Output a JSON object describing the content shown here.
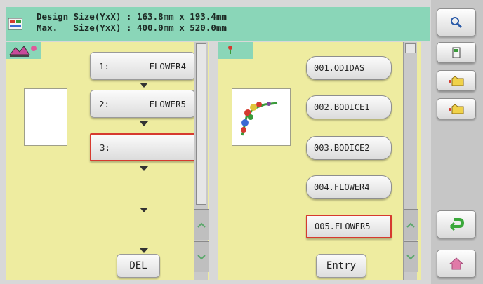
{
  "header": {
    "line1": "Design Size(YxX) : 163.8mm x 193.4mm",
    "line2": "Max.   Size(YxX) : 400.0mm x 520.0mm"
  },
  "left_list": {
    "items": [
      {
        "num": "1:",
        "name": "FLOWER4"
      },
      {
        "num": "2:",
        "name": "FLOWER5"
      },
      {
        "num": "3:",
        "name": ""
      }
    ],
    "del_label": "DEL"
  },
  "pattern_list": {
    "items": [
      "001.ODIDAS",
      "002.BODICE1",
      "003.BODICE2",
      "004.FLOWER4",
      "005.FLOWER5"
    ],
    "entry_label": "Entry"
  },
  "colors": {
    "header_bg": "#8ad6b8",
    "panel_bg": "#eeeca0",
    "selected_border": "#d63a2f",
    "toolbar_bg": "#c6c6c6"
  },
  "icons": {
    "toolbar": [
      "magnifier-icon",
      "bobbin-icon",
      "folder-in-icon",
      "folder-out-icon",
      "return-icon",
      "home-icon"
    ]
  }
}
